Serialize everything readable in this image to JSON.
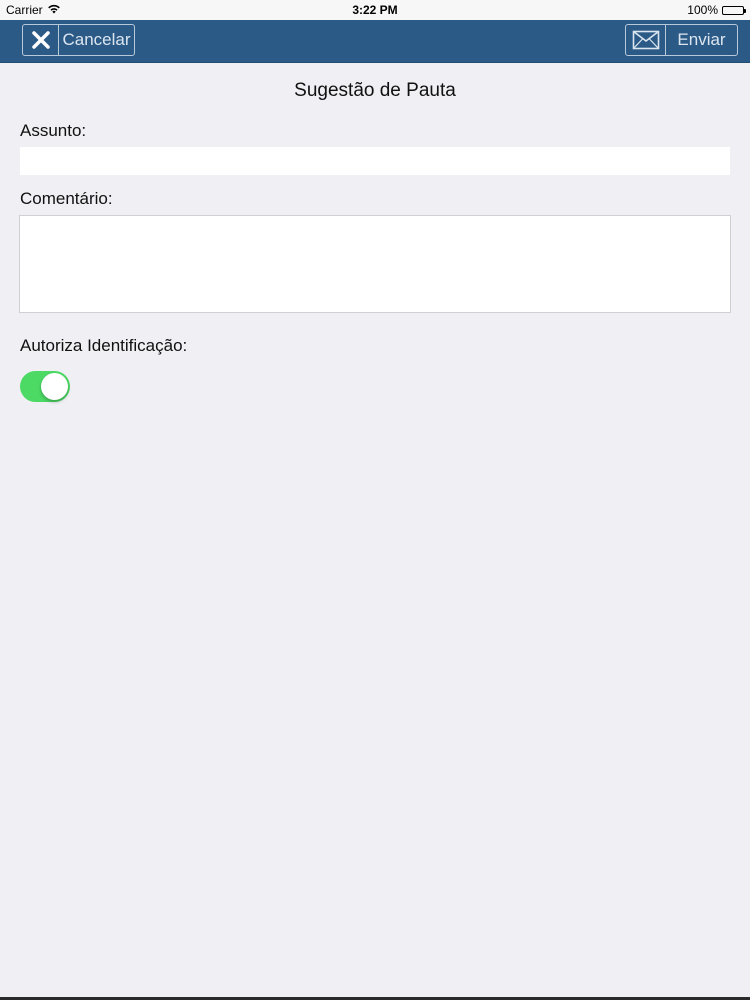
{
  "status_bar": {
    "carrier": "Carrier",
    "time": "3:22 PM",
    "battery": "100%"
  },
  "navbar": {
    "cancel_label": "Cancelar",
    "send_label": "Enviar"
  },
  "form": {
    "title": "Sugestão de Pauta",
    "subject_label": "Assunto:",
    "subject_value": "",
    "comment_label": "Comentário:",
    "comment_value": "",
    "authorize_label": "Autoriza Identificação:",
    "authorize_on": true
  },
  "colors": {
    "navbar": "#2c5a87",
    "toggle_on": "#4cd964",
    "background": "#efeff4"
  }
}
